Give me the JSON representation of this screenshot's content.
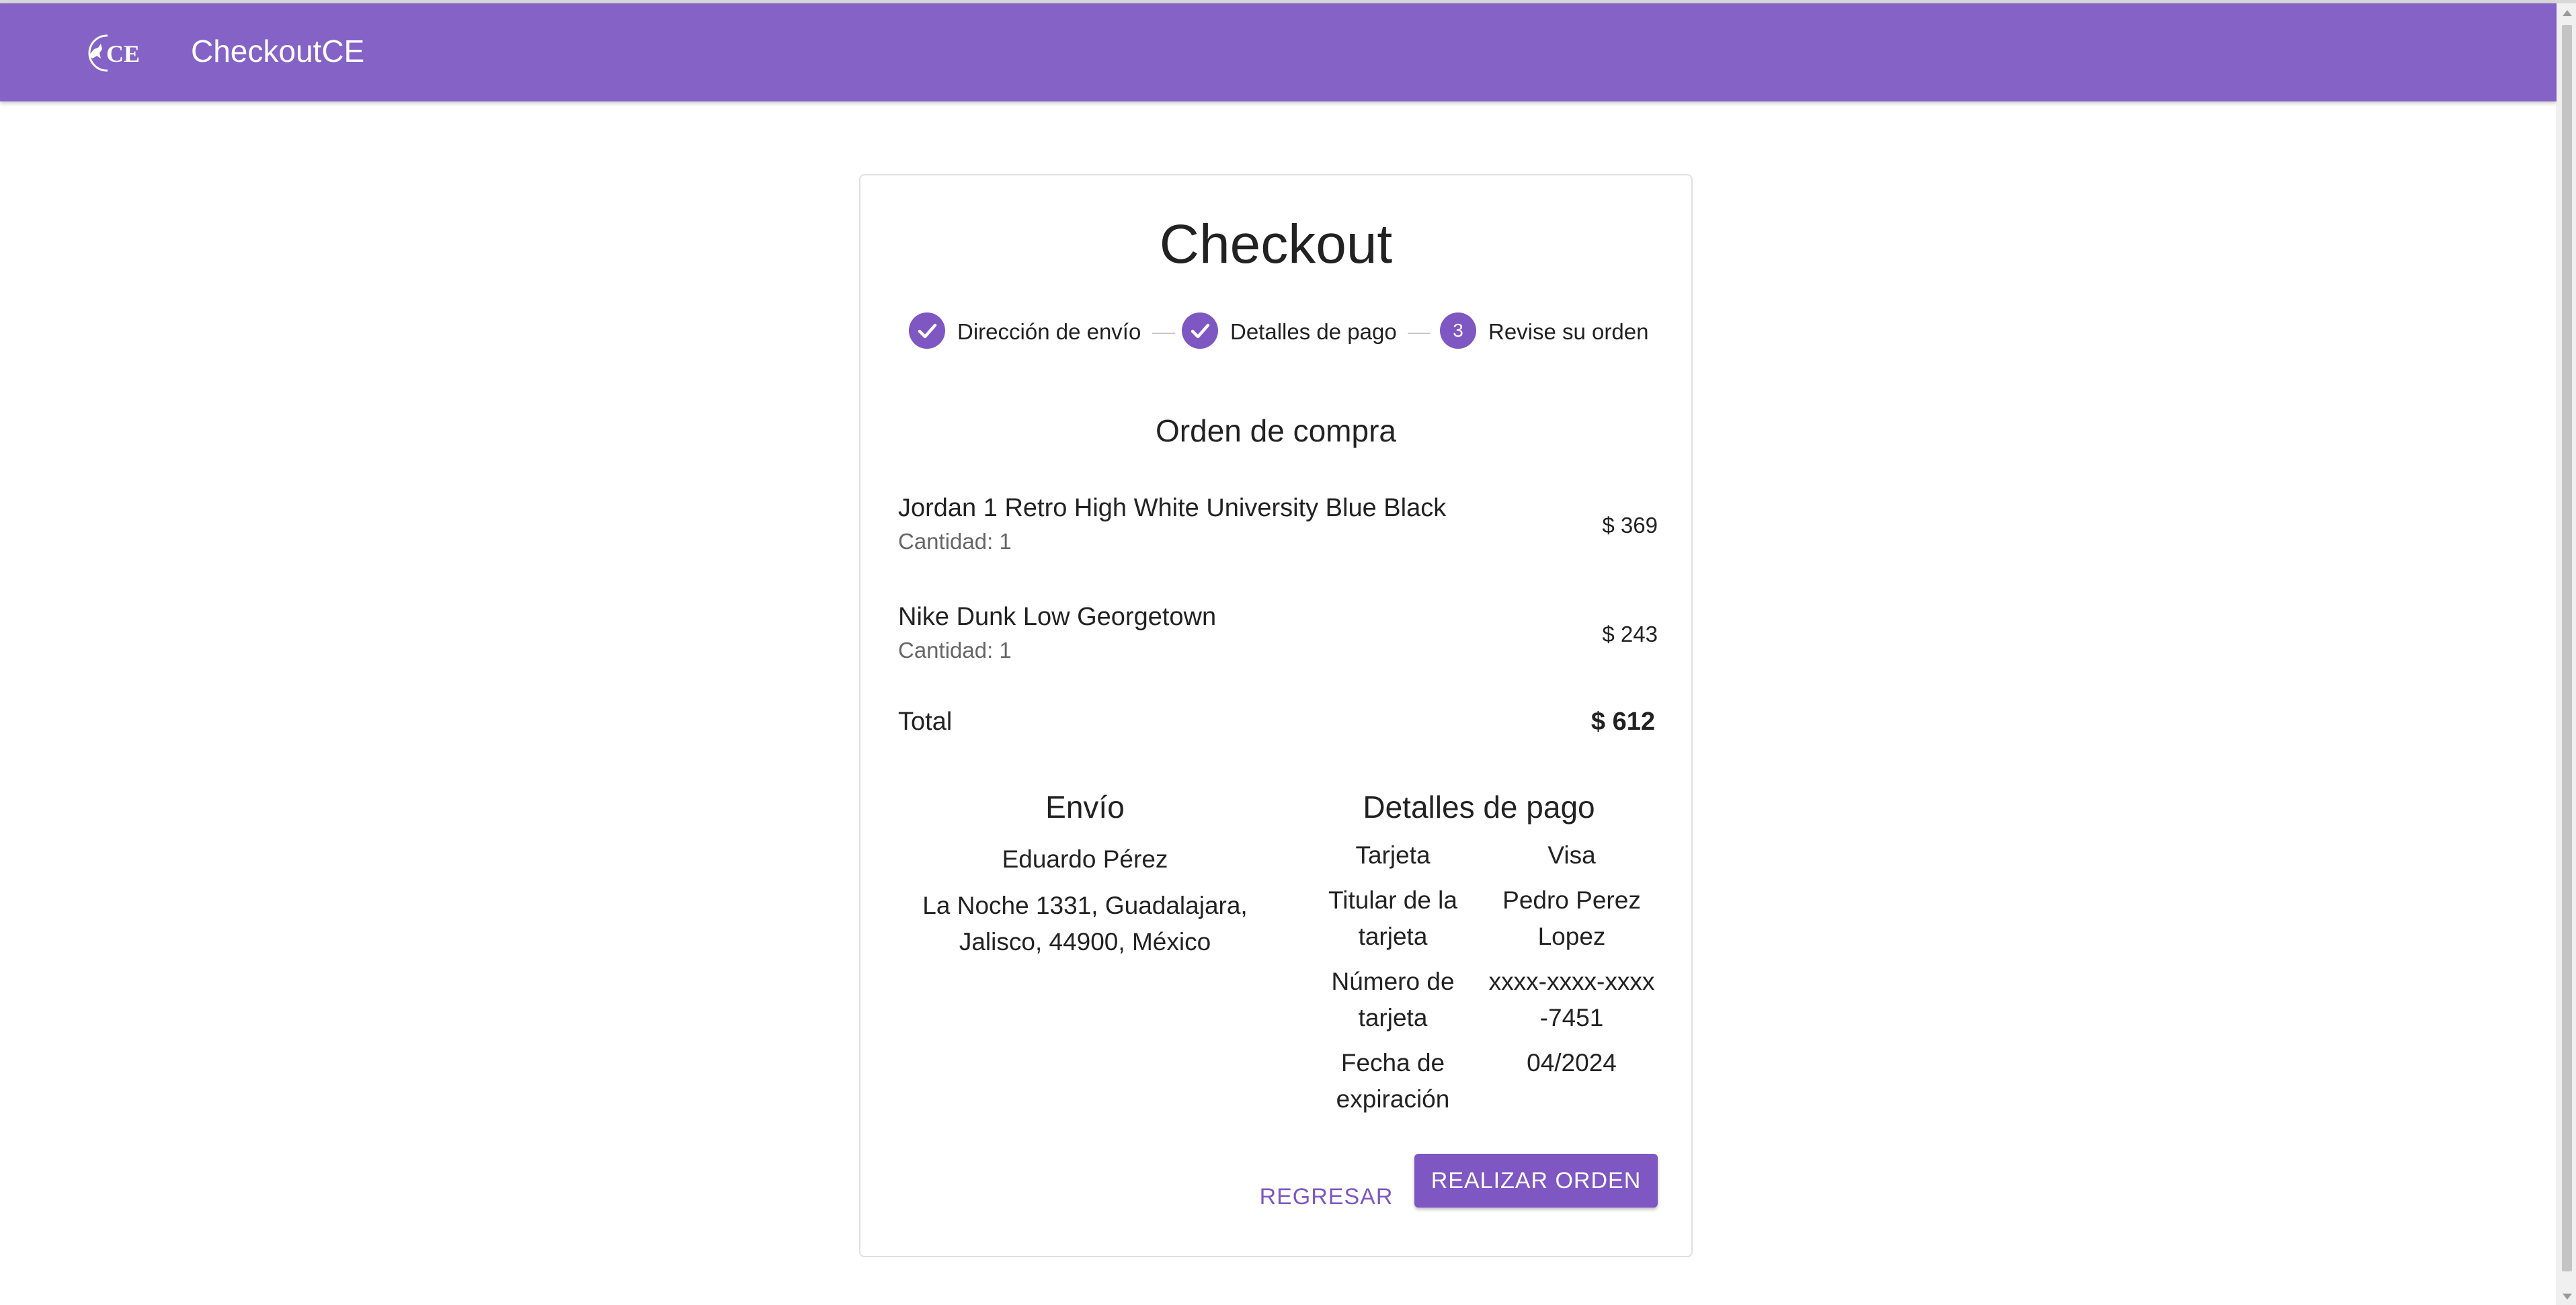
{
  "app": {
    "logo_text": "CE",
    "title": "CheckoutCE"
  },
  "checkout": {
    "title": "Checkout",
    "steps": [
      {
        "label": "Dirección de envío",
        "state": "completed"
      },
      {
        "label": "Detalles de pago",
        "state": "completed"
      },
      {
        "label": "Revise su orden",
        "state": "active",
        "number": "3"
      }
    ],
    "order_title": "Orden de compra",
    "items": [
      {
        "name": "Jordan 1 Retro High White University Blue Black",
        "quantity": "Cantidad: 1",
        "price": "$ 369"
      },
      {
        "name": "Nike Dunk Low Georgetown",
        "quantity": "Cantidad: 1",
        "price": "$ 243"
      }
    ],
    "total_label": "Total",
    "total_value": "$ 612",
    "shipping": {
      "title": "Envío",
      "name": "Eduardo Pérez",
      "address": "La Noche 1331, Guadalajara, Jalisco, 44900, México"
    },
    "payment": {
      "title": "Detalles de pago",
      "rows": [
        {
          "key": "Tarjeta",
          "value": "Visa"
        },
        {
          "key": "Titular de la tarjeta",
          "value": "Pedro Perez Lopez"
        },
        {
          "key": "Número de tarjeta",
          "value": "xxxx-xxxx-xxxx-7451"
        },
        {
          "key": "Fecha de expiración",
          "value": "04/2024"
        }
      ]
    },
    "buttons": {
      "back": "Regresar",
      "submit": "Realizar orden"
    }
  },
  "colors": {
    "primary": "#8462c6",
    "accent": "#7e57c2"
  }
}
